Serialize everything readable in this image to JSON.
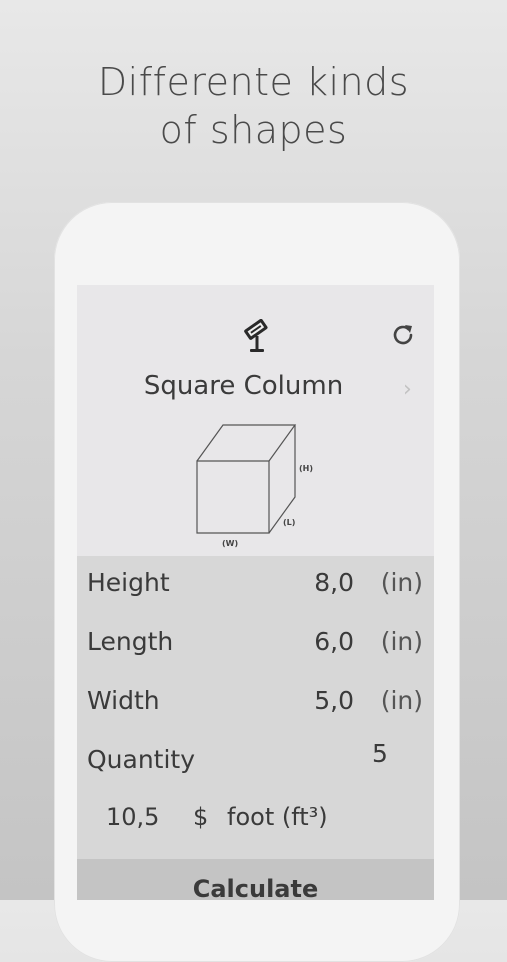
{
  "headline": {
    "line1": "Differente kinds",
    "line2": "of shapes"
  },
  "app": {
    "icons": {
      "logo": "paint-roller-icon",
      "refresh": "refresh-icon",
      "next": "chevron-right-icon"
    },
    "shape_title": "Square Column",
    "next_chevron": "›",
    "diagram_labels": {
      "height": "(H)",
      "length": "(L)",
      "width": "(W)"
    },
    "fields": [
      {
        "label": "Height",
        "value": "8,0",
        "unit": "(in)"
      },
      {
        "label": "Length",
        "value": "6,0",
        "unit": "(in)"
      },
      {
        "label": "Width",
        "value": "5,0",
        "unit": "(in)"
      }
    ],
    "quantity": {
      "label": "Quantity",
      "value": "5"
    },
    "price": {
      "value": "10,5",
      "currency": "$",
      "unit": "foot (ft³)"
    },
    "calculate_label": "Calculate"
  },
  "colors": {
    "background_top": "#e8e8e8",
    "background_bottom": "#c4c4c4",
    "screen": "#e8e7e9",
    "fields_panel": "#d7d7d7",
    "button": "#c4c4c4",
    "text": "#3a3a3a"
  }
}
